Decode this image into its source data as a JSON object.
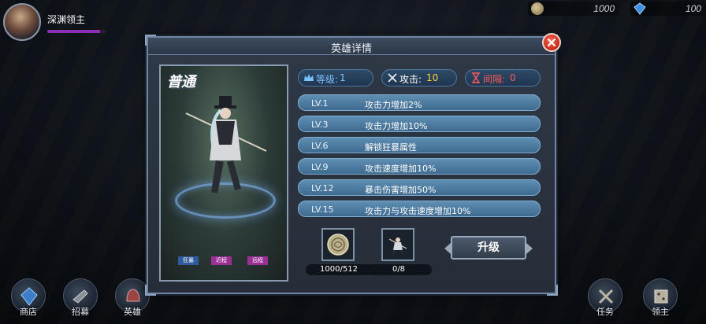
{
  "player": {
    "name": "深渊领主",
    "exp_fraction": 0.9
  },
  "currency": {
    "gold": "1000",
    "gems": "100"
  },
  "nav": {
    "shop": "商店",
    "recruit": "招募",
    "hero": "英雄",
    "task": "任务",
    "lord": "领主"
  },
  "modal": {
    "title": "英雄详情",
    "hero": {
      "rarity": "普通",
      "tags": [
        "狂暴",
        "近程",
        "远程"
      ]
    },
    "stats": {
      "level_label": "等级:",
      "level_value": "1",
      "attack_label": "攻击:",
      "attack_value": "10",
      "interval_label": "间隔:",
      "interval_value": "0"
    },
    "skills": [
      {
        "level": "LV.1",
        "desc": "攻击力增加2%"
      },
      {
        "level": "LV.3",
        "desc": "攻击力增加10%"
      },
      {
        "level": "LV.6",
        "desc": "解锁狂暴属性"
      },
      {
        "level": "LV.9",
        "desc": "攻击速度增加10%"
      },
      {
        "level": "LV.12",
        "desc": "暴击伤害增加50%"
      },
      {
        "level": "LV.15",
        "desc": "攻击力与攻击速度增加10%"
      }
    ],
    "materials": {
      "coin_count": "1000/512",
      "shard_count": "0/8"
    },
    "upgrade_label": "升级"
  },
  "colors": {
    "accent": "#7ec1ff",
    "attack": "#ffd23a",
    "interval": "#ff5a5a",
    "skill_bar": "#4f7fa5"
  },
  "icons": {
    "level": "crown-icon",
    "attack": "crossed-swords-icon",
    "interval": "hourglass-icon",
    "close": "close-icon",
    "gold": "coin-icon",
    "gems": "diamond-icon"
  }
}
